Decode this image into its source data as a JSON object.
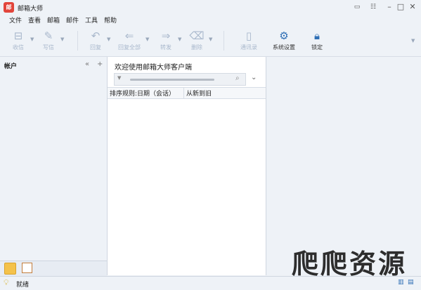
{
  "window": {
    "title": "邮箱大师",
    "logo_glyph": "邮"
  },
  "menu": [
    "文件",
    "查看",
    "邮箱",
    "邮件",
    "工具",
    "帮助"
  ],
  "toolbar": {
    "receive": "收信",
    "compose": "写信",
    "reply": "回复",
    "reply_all": "回复全部",
    "forward": "转发",
    "delete": "删除",
    "contacts": "通讯录",
    "settings": "系统设置",
    "lock": "锁定"
  },
  "left_pane": {
    "title": "帐户"
  },
  "middle_pane": {
    "welcome": "欢迎使用邮箱大师客户端",
    "sort_label": "排序规则:日期（会话）",
    "sort_order": "从新到旧"
  },
  "watermark": "爬爬资源",
  "status": {
    "text": "就绪"
  },
  "colors": {
    "accent": "#2f6fb5",
    "logo": "#e2453b",
    "disabled": "#a9b8cc"
  }
}
